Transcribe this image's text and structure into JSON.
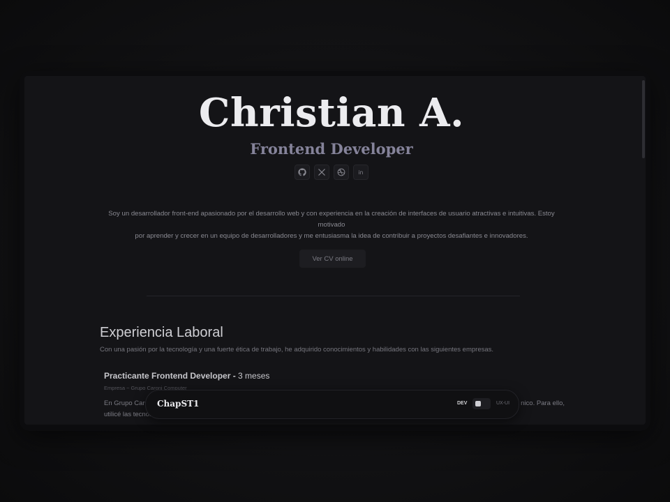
{
  "hero": {
    "name": "Christian A.",
    "role": "Frontend Developer",
    "socials": [
      {
        "icon": "github-icon",
        "label": "GitHub"
      },
      {
        "icon": "x-icon",
        "label": "X"
      },
      {
        "icon": "dribbble-icon",
        "label": "Dribbble"
      },
      {
        "icon": "linkedin-icon",
        "label": "in"
      }
    ]
  },
  "bio": {
    "line1": "Soy un desarrollador front-end apasionado por el desarrollo web y con experiencia en la creación de interfaces de usuario atractivas e intuitivas. Estoy motivado",
    "line2": "por aprender y crecer en un equipo de desarrolladores y me entusiasma la idea de contribuir a proyectos desafiantes e innovadores."
  },
  "cv_button": {
    "label": "Ver CV online"
  },
  "experience": {
    "title": "Experiencia Laboral",
    "subtitle": "Con una pasión por la tecnología y una fuerte ética de trabajo, he adquirido conocimientos y habilidades con las siguientes empresas.",
    "jobs": [
      {
        "role": "Practicante Frontend Developer - ",
        "duration": "3 meses",
        "company": "Empresa ~ Grupo Caroni Computer",
        "desc_line1": "En Grupo Caroni Computer …",
        "desc_tail": "nico. Para ello,",
        "desc_line2": "utilicé las tecnolog…"
      }
    ]
  },
  "dock": {
    "logo": "ChapST1",
    "toggle_left": "DEV",
    "toggle_right": "UX-UI"
  },
  "colors": {
    "background": "#141417",
    "accent_role": "#85839a",
    "text_primary": "#ececef"
  }
}
